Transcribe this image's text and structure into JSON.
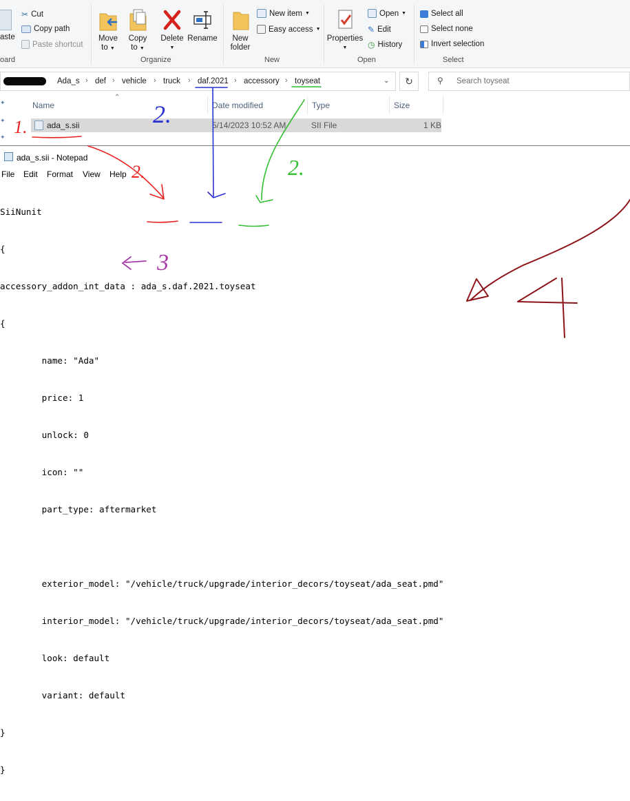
{
  "ribbon": {
    "clipboard": {
      "paste_partial": "aste",
      "cut": "Cut",
      "copy_path": "Copy path",
      "paste_shortcut": "Paste shortcut",
      "group_label_partial": "oard"
    },
    "organize": {
      "move_to_line1": "Move",
      "move_to_line2": "to",
      "copy_to_line1": "Copy",
      "copy_to_line2": "to",
      "delete": "Delete",
      "rename": "Rename",
      "group_label": "Organize"
    },
    "new": {
      "new_folder_line1": "New",
      "new_folder_line2": "folder",
      "new_item": "New item",
      "easy_access": "Easy access",
      "group_label": "New"
    },
    "open": {
      "properties": "Properties",
      "open": "Open",
      "edit": "Edit",
      "history": "History",
      "group_label": "Open"
    },
    "select": {
      "select_all": "Select all",
      "select_none": "Select none",
      "invert_selection": "Invert selection",
      "group_label": "Select"
    }
  },
  "address_bar": {
    "crumbs": [
      "Ada_s",
      "def",
      "vehicle",
      "truck",
      "daf.2021",
      "accessory",
      "toyseat"
    ]
  },
  "search": {
    "placeholder": "Search toyseat"
  },
  "file_list": {
    "columns": {
      "name": "Name",
      "date": "Date modified",
      "type": "Type",
      "size": "Size"
    },
    "rows": [
      {
        "name": "ada_s.sii",
        "date": "5/14/2023 10:52 AM",
        "type": "SII File",
        "size": "1 KB"
      }
    ]
  },
  "notepad": {
    "title": "ada_s.sii - Notepad",
    "menu": [
      "File",
      "Edit",
      "Format",
      "View",
      "Help"
    ],
    "lines": [
      "SiiNunit",
      "{",
      "accessory_addon_int_data : ada_s.daf.2021.toyseat",
      "{",
      "        name: \"Ada\"",
      "        price: 1",
      "        unlock: 0",
      "        icon: \"\"",
      "        part_type: aftermarket",
      "",
      "        exterior_model: \"/vehicle/truck/upgrade/interior_decors/toyseat/ada_seat.pmd\"",
      "        interior_model: \"/vehicle/truck/upgrade/interior_decors/toyseat/ada_seat.pmd\"",
      "        look: default",
      "        variant: default",
      "}",
      "}"
    ]
  },
  "annotations": {
    "label_1": "1.",
    "label_2_blue": "2.",
    "label_2_red": "2.",
    "label_2_green": "2.",
    "label_3": "3",
    "label_4": "4",
    "colors": {
      "red": "#e8201f",
      "blue": "#2a31d4",
      "green": "#2fbf2f",
      "purple": "#a63ba8",
      "darkred": "#8c1419"
    }
  }
}
